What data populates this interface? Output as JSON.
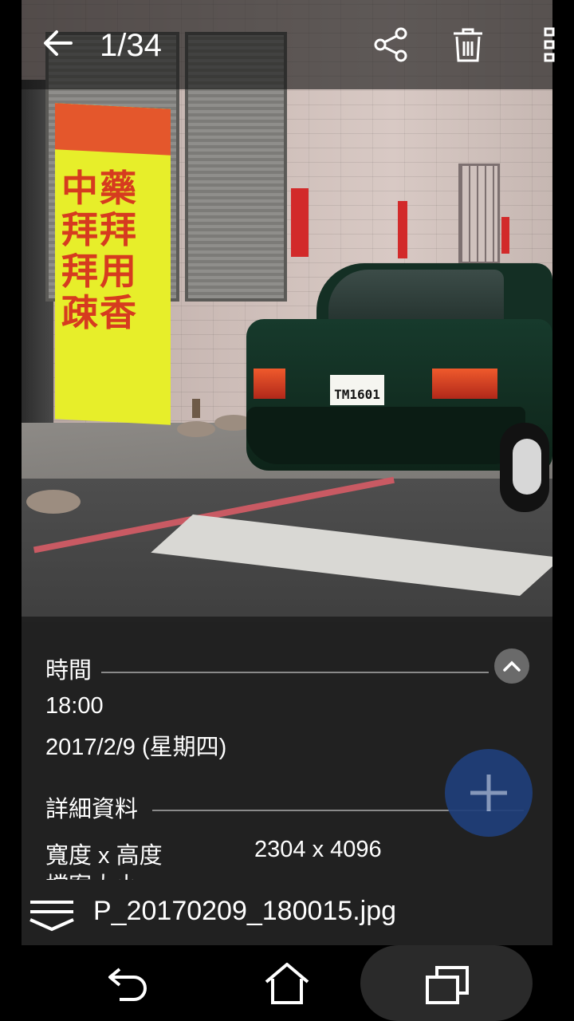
{
  "topbar": {
    "counter": "1/34",
    "icons": [
      "back-arrow-icon",
      "share-icon",
      "trash-icon",
      "more-vert-icon"
    ]
  },
  "photo": {
    "banner_text": "中藥拜拜 拜用疎香",
    "plate_text": "TM1601"
  },
  "info": {
    "time_heading": "時間",
    "time_value": "18:00",
    "date_value": "2017/2/9 (星期四)",
    "details_heading": "詳細資料",
    "size_label": "寬度 x 高度",
    "size_value": "2304 x 4096",
    "partial_label": "檔案大小"
  },
  "filebar": {
    "filename": "P_20170209_180015.jpg"
  },
  "navbar": {
    "icons": [
      "back-icon",
      "home-icon",
      "recents-icon"
    ]
  },
  "colors": {
    "fab": "#1f3f7a",
    "panel": "#202020"
  }
}
